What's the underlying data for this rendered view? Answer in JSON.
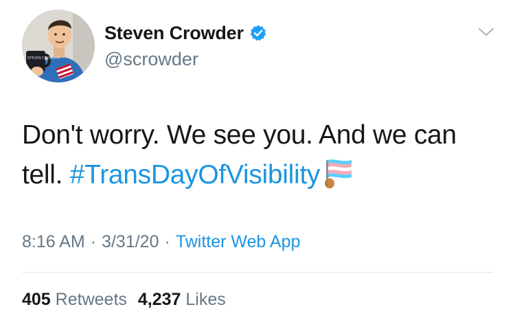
{
  "author": {
    "display_name": "Steven Crowder",
    "handle": "@scrowder",
    "verified": true,
    "avatar_mug_text": "STEVEN CROWDER"
  },
  "tweet": {
    "text_prefix": "Don't worry. We see you. And we can tell.",
    "hashtag": "#TransDayOfVisibility",
    "emoji": "transgender-flag-emoji"
  },
  "meta": {
    "time": "8:16 AM",
    "separator": "·",
    "date": "3/31/20",
    "source": "Twitter Web App"
  },
  "stats": {
    "retweets_count": "405",
    "retweets_label": "Retweets",
    "likes_count": "4,237",
    "likes_label": "Likes"
  },
  "colors": {
    "link_blue": "#1b95e0",
    "text": "#14171a",
    "secondary": "#657786",
    "divider": "#e1e8ed"
  }
}
